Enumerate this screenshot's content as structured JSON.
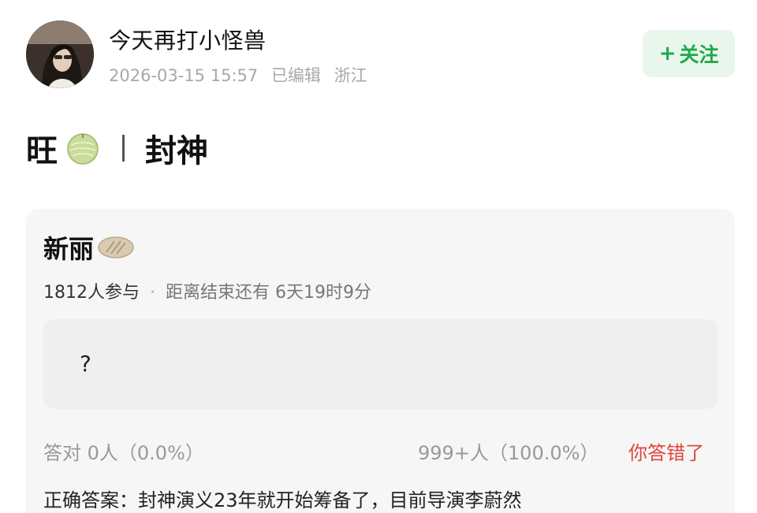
{
  "header": {
    "username": "今天再打小怪兽",
    "timestamp": "2026-03-15 15:57",
    "edited": "已编辑",
    "location": "浙江",
    "follow_plus": "+",
    "follow_label": "关注",
    "accent_color": "#1fa94a"
  },
  "post": {
    "title_left": "旺",
    "title_right": "封神",
    "emoji_icon": "melon-icon"
  },
  "quiz": {
    "title": "新丽",
    "title_icon": "cookie-icon",
    "participants": "1812人参与",
    "separator": "·",
    "time_remaining": "距离结束还有 6天19时9分",
    "option": "?",
    "correct_stat": "答对  0人（0.0%）",
    "wrong_stat": "999+人（100.0%）",
    "result": "你答错了",
    "answer": "正确答案：封神演义23年就开始筹备了，目前导演李蔚然",
    "wrong_color": "#e0453a"
  }
}
